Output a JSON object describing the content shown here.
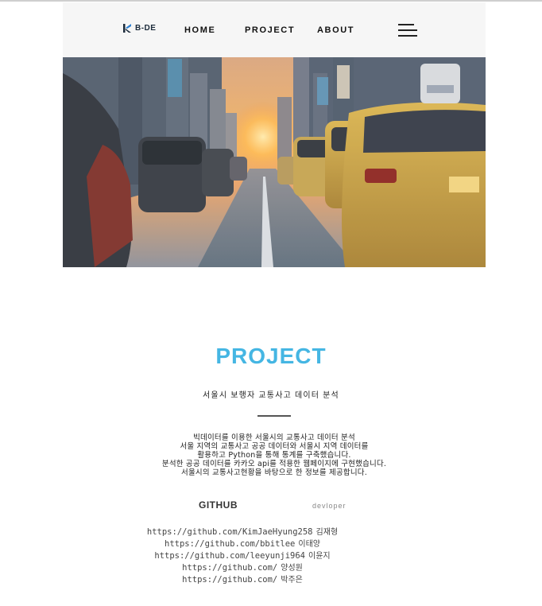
{
  "nav": {
    "logo_text": "B-DE",
    "home": "HOME",
    "project": "PROJECT",
    "about": "ABOUT",
    "menu_icon": "hamburger-menu-icon"
  },
  "hero": {
    "image": "city-street-taxis-sunset"
  },
  "project": {
    "title": "PROJECT",
    "subtitle": "서울시 보행자 교통사고 데이터 분석",
    "description": [
      "빅데이터를 이용한 서울시의 교통사고 데이터 분석",
      "서울 지역의 교통사고 공공 데이터와 서울시 지역 데이터를",
      "활용하고 Python을 통해 통계를 구축했습니다.",
      "분석한 공공 데이터를 카카오 api를 적용한 웹페이지에 구현했습니다.",
      "서울시의 교통사고현황을 바탕으로 한 정보를 제공합니다."
    ]
  },
  "github": {
    "title": "GITHUB",
    "developer_label": "devloper",
    "links": [
      {
        "url": "https://github.com/KimJaeHyung258",
        "name": "김재형"
      },
      {
        "url": "https://github.com/bbitlee",
        "name": "이태양"
      },
      {
        "url": "https://github.com/leeyunji964",
        "name": "이윤지"
      },
      {
        "url": "https://github.com/",
        "name": "양성원"
      },
      {
        "url": "https://github.com/",
        "name": "박주은"
      }
    ]
  },
  "colors": {
    "accent": "#45b6e3",
    "navbar_bg": "#f6f6f6"
  }
}
